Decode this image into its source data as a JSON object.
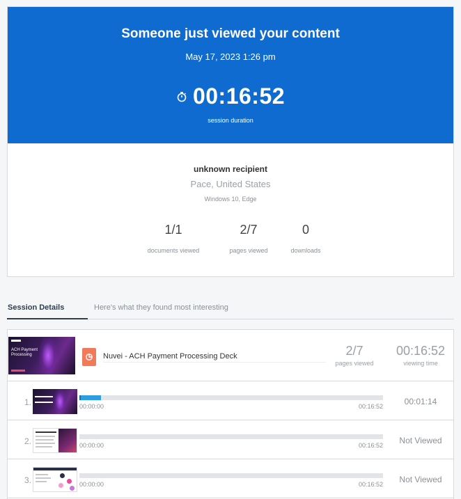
{
  "hero": {
    "title": "Someone just viewed your content",
    "date": "May 17, 2023 1:26 pm",
    "duration": "00:16:52",
    "duration_label": "session duration",
    "timer_icon": "stopwatch-icon"
  },
  "recipient": {
    "name": "unknown recipient",
    "location": "Pace, United States",
    "device": "Windows 10, Edge"
  },
  "stats": {
    "documents": {
      "value": "1/1",
      "label": "documents viewed"
    },
    "pages": {
      "value": "2/7",
      "label": "pages viewed"
    },
    "downloads": {
      "value": "0",
      "label": "downloads"
    }
  },
  "tabs": {
    "active": "Session Details",
    "inactive": "Here's what they found most interesting"
  },
  "document": {
    "thumb_text": "ACH Payment Processing",
    "icon": "presentation-file-icon",
    "name": "Nuvei - ACH Payment Processing Deck",
    "pages_value": "2/7",
    "pages_label": "pages viewed",
    "time_value": "00:16:52",
    "time_label": "viewing time"
  },
  "pages": [
    {
      "num": "1.",
      "start": "00:00:00",
      "end": "00:16:52",
      "time": "00:01:14",
      "progress": 0.07
    },
    {
      "num": "2.",
      "start": "00:00:00",
      "end": "00:16:52",
      "time": "Not Viewed",
      "progress": 0
    },
    {
      "num": "3.",
      "start": "00:00:00",
      "end": "00:16:52",
      "time": "Not Viewed",
      "progress": 0
    }
  ],
  "colors": {
    "hero_bg": "#0f6bcf",
    "progress_fill": "#2d9ee0",
    "doc_icon": "#f07a5a"
  }
}
